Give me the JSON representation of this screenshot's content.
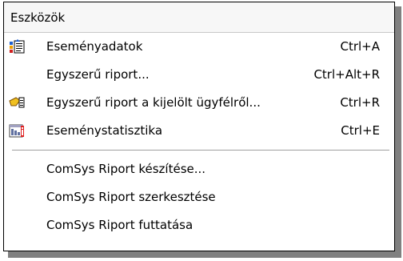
{
  "menu": {
    "title": "Eszközök",
    "items": [
      {
        "label": "Eseményadatok",
        "shortcut": "Ctrl+A",
        "icon": "event-data-icon"
      },
      {
        "label": "Egyszerű riport...",
        "shortcut": "Ctrl+Alt+R",
        "icon": ""
      },
      {
        "label": "Egyszerű riport a kijelölt ügyfélről...",
        "shortcut": "Ctrl+R",
        "icon": "client-report-icon"
      },
      {
        "label": "Eseménystatisztika",
        "shortcut": "Ctrl+E",
        "icon": "event-statistics-icon"
      }
    ],
    "items_after_separator": [
      {
        "label": "ComSys Riport készítése..."
      },
      {
        "label": "ComSys Riport szerkesztése"
      },
      {
        "label": "ComSys Riport futtatása"
      }
    ]
  },
  "colors": {
    "border": "#000000",
    "shadow": "#808080",
    "header_bg": "#f7f7f7"
  }
}
